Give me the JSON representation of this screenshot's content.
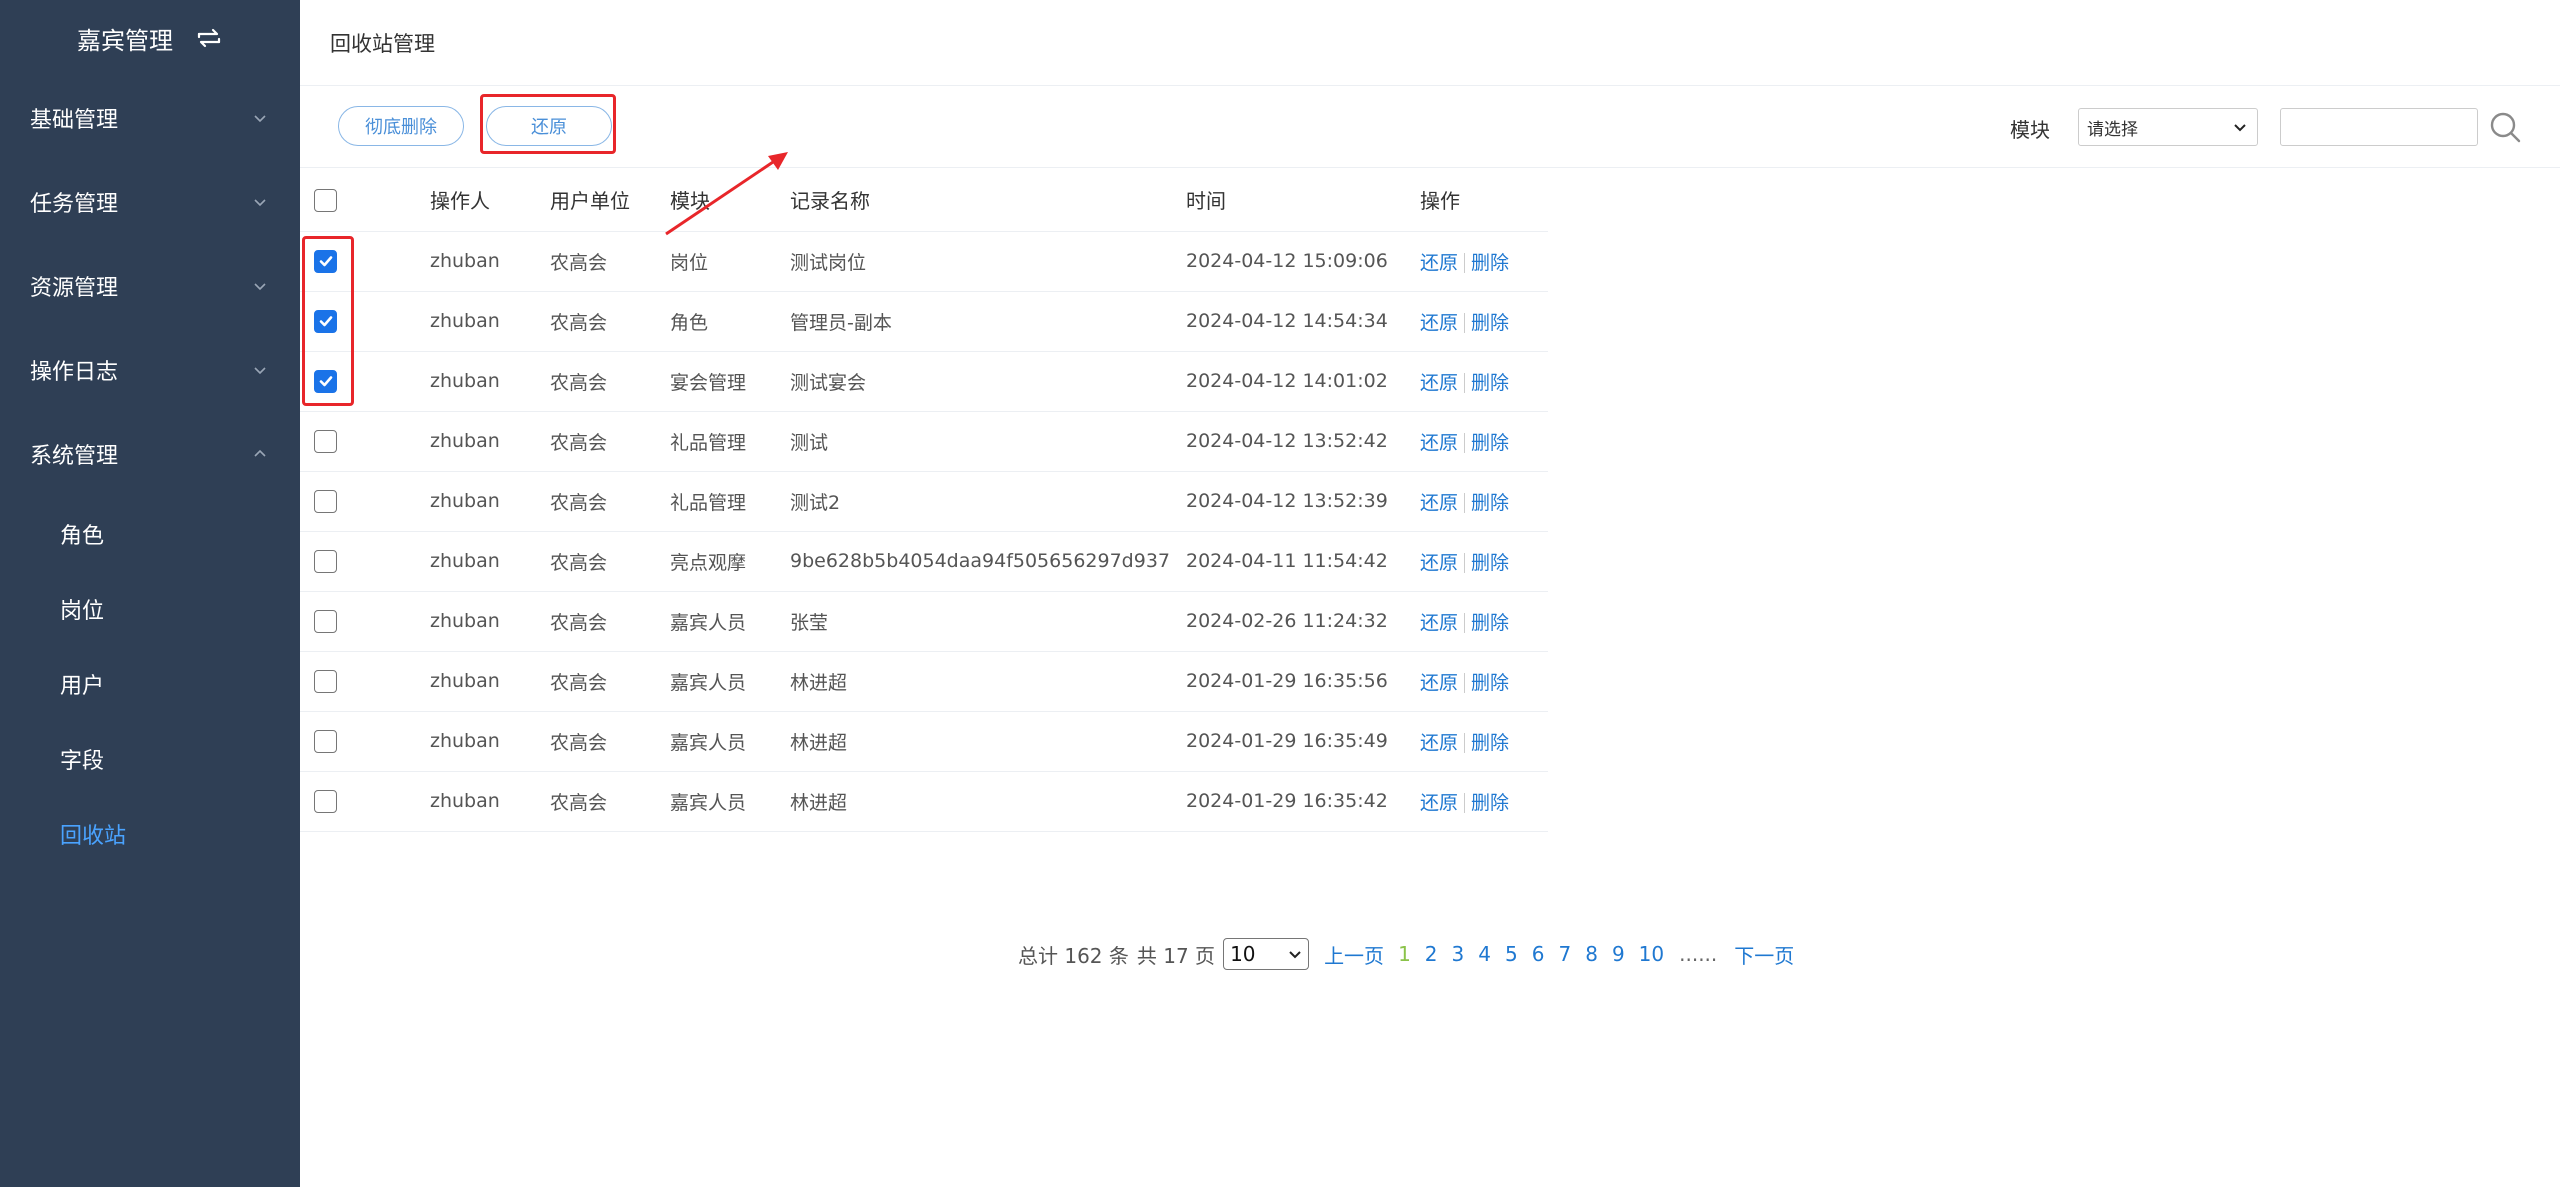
{
  "sidebar": {
    "brand": "嘉宾管理",
    "menus": [
      {
        "label": "基础管理",
        "expanded": false
      },
      {
        "label": "任务管理",
        "expanded": false
      },
      {
        "label": "资源管理",
        "expanded": false
      },
      {
        "label": "操作日志",
        "expanded": false
      },
      {
        "label": "系统管理",
        "expanded": true
      }
    ],
    "sub_items": [
      {
        "label": "角色",
        "active": false
      },
      {
        "label": "岗位",
        "active": false
      },
      {
        "label": "用户",
        "active": false
      },
      {
        "label": "字段",
        "active": false
      },
      {
        "label": "回收站",
        "active": true
      }
    ]
  },
  "header": {
    "title": "回收站管理"
  },
  "toolbar": {
    "delete_label": "彻底删除",
    "restore_label": "还原",
    "module_label": "模块",
    "module_select_value": "请选择",
    "search_value": ""
  },
  "table": {
    "columns": [
      "操作人",
      "用户单位",
      "模块",
      "记录名称",
      "时间",
      "操作"
    ],
    "action_restore": "还原",
    "action_delete": "删除",
    "rows": [
      {
        "checked": true,
        "operator": "zhuban",
        "unit": "农高会",
        "module": "岗位",
        "name": "测试岗位",
        "time": "2024-04-12 15:09:06"
      },
      {
        "checked": true,
        "operator": "zhuban",
        "unit": "农高会",
        "module": "角色",
        "name": "管理员-副本",
        "time": "2024-04-12 14:54:34"
      },
      {
        "checked": true,
        "operator": "zhuban",
        "unit": "农高会",
        "module": "宴会管理",
        "name": "测试宴会",
        "time": "2024-04-12 14:01:02"
      },
      {
        "checked": false,
        "operator": "zhuban",
        "unit": "农高会",
        "module": "礼品管理",
        "name": "测试",
        "time": "2024-04-12 13:52:42"
      },
      {
        "checked": false,
        "operator": "zhuban",
        "unit": "农高会",
        "module": "礼品管理",
        "name": "测试2",
        "time": "2024-04-12 13:52:39"
      },
      {
        "checked": false,
        "operator": "zhuban",
        "unit": "农高会",
        "module": "亮点观摩",
        "name": "9be628b5b4054daa94f505656297d937",
        "time": "2024-04-11 11:54:42"
      },
      {
        "checked": false,
        "operator": "zhuban",
        "unit": "农高会",
        "module": "嘉宾人员",
        "name": "张莹",
        "time": "2024-02-26 11:24:32"
      },
      {
        "checked": false,
        "operator": "zhuban",
        "unit": "农高会",
        "module": "嘉宾人员",
        "name": "林进超",
        "time": "2024-01-29 16:35:56"
      },
      {
        "checked": false,
        "operator": "zhuban",
        "unit": "农高会",
        "module": "嘉宾人员",
        "name": "林进超",
        "time": "2024-01-29 16:35:49"
      },
      {
        "checked": false,
        "operator": "zhuban",
        "unit": "农高会",
        "module": "嘉宾人员",
        "name": "林进超",
        "time": "2024-01-29 16:35:42"
      }
    ]
  },
  "pagination": {
    "total_text": "总计 162 条",
    "pages_text": "共 17 页",
    "page_size": "10",
    "prev_label": "上一页",
    "next_label": "下一页",
    "pages": [
      "1",
      "2",
      "3",
      "4",
      "5",
      "6",
      "7",
      "8",
      "9",
      "10"
    ],
    "current_page": "1",
    "ellipsis": "......"
  },
  "colors": {
    "sidebar_bg": "#2f3f55",
    "accent": "#1f78d1",
    "active_sub": "#4aa3ff",
    "highlight": "#e8262a",
    "current_page": "#8bc34a"
  }
}
